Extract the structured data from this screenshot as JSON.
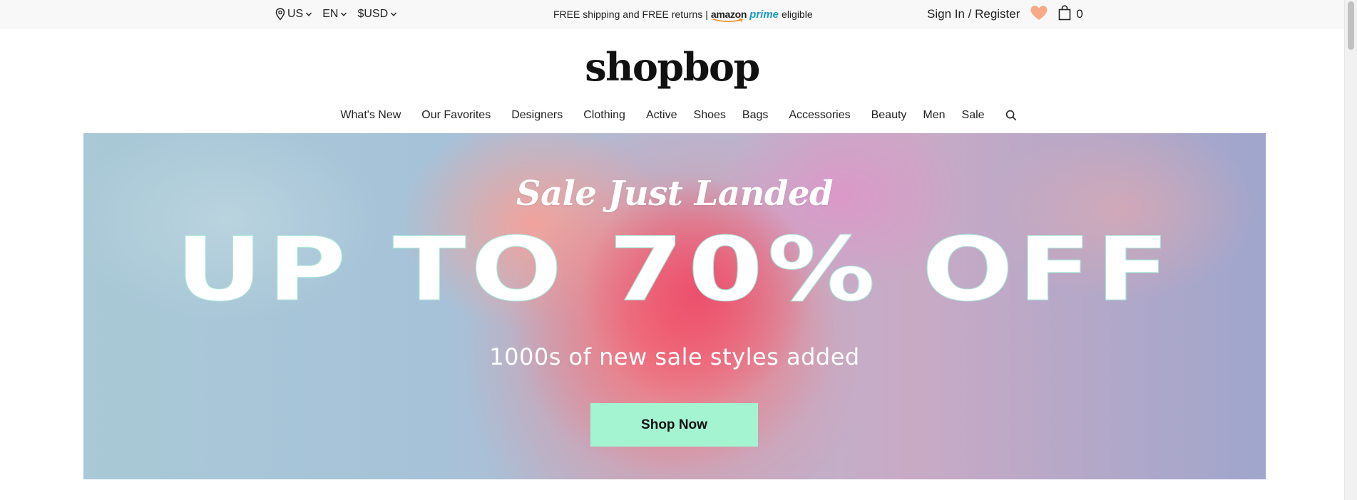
{
  "utility": {
    "country": "US",
    "language": "EN",
    "currency": "$USD",
    "shipping_text": "FREE shipping and FREE returns |",
    "amazon_text": "amazon",
    "prime_text": "prime",
    "eligible_text": "eligible",
    "sign_in": "Sign In / Register",
    "bag_count": "0"
  },
  "logo": "shopbop",
  "nav": {
    "items": [
      "What's New",
      "Our Favorites",
      "Designers",
      "Clothing",
      "Active",
      "Shoes",
      "Bags",
      "Accessories",
      "Beauty",
      "Men",
      "Sale"
    ]
  },
  "hero": {
    "subtitle": "Sale Just Landed",
    "headline": "UP TO 70% OFF",
    "description": "1000s of new sale styles added",
    "cta": "Shop Now"
  },
  "colors": {
    "heart": "#f7a98a",
    "cta_bg": "#a4f4d2",
    "prime_blue": "#1a98c5"
  },
  "icons": [
    "location-pin-icon",
    "chevron-down-icon",
    "heart-icon",
    "shopping-bag-icon",
    "search-icon"
  ]
}
